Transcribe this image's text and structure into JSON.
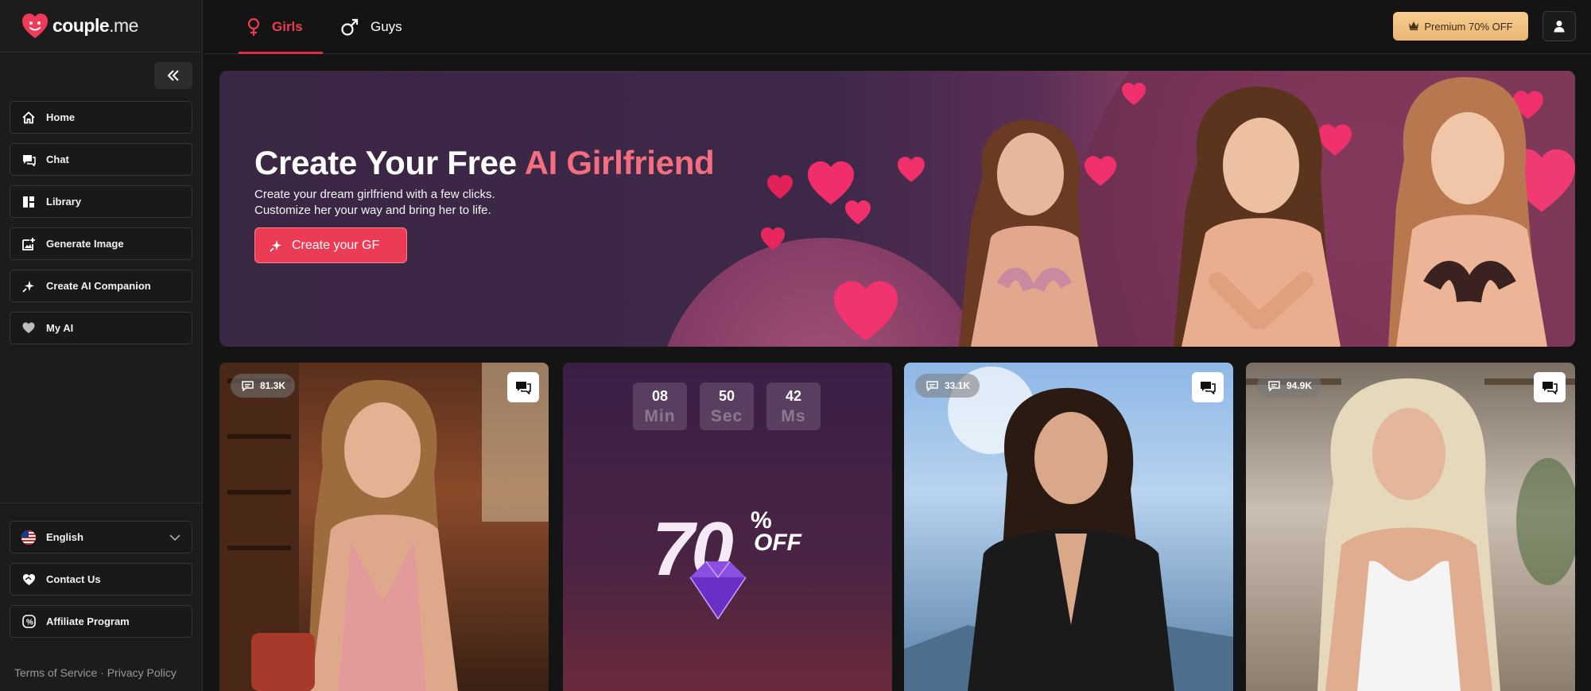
{
  "brand": {
    "name_bold": "couple",
    "name_rest": ".me"
  },
  "sidebar": {
    "items": [
      {
        "label": "Home",
        "icon": "home-icon"
      },
      {
        "label": "Chat",
        "icon": "chat-icon"
      },
      {
        "label": "Library",
        "icon": "library-icon"
      },
      {
        "label": "Generate Image",
        "icon": "generate-image-icon"
      },
      {
        "label": "Create AI Companion",
        "icon": "sparkle-icon"
      },
      {
        "label": "My AI",
        "icon": "heart-icon"
      }
    ],
    "language": {
      "label": "English",
      "icon": "us-flag-icon"
    },
    "contact_label": "Contact Us",
    "affiliate_label": "Affiliate Program",
    "terms_label": "Terms of Service",
    "separator": "·",
    "privacy_label": "Privacy Policy"
  },
  "topbar": {
    "tabs": [
      {
        "label": "Girls",
        "active": true
      },
      {
        "label": "Guys",
        "active": false
      }
    ],
    "premium_label": "Premium 70% OFF"
  },
  "hero": {
    "title_main": "Create Your Free",
    "title_accent": "AI Girlfriend",
    "subtitle_line1": "Create your dream girlfriend with a few clicks.",
    "subtitle_line2": "Customize her your way and bring her to life.",
    "cta_label": "Create your GF"
  },
  "cards": [
    {
      "count": "81.3K"
    },
    {
      "promo": true
    },
    {
      "count": "33.1K"
    },
    {
      "count": "94.9K"
    }
  ],
  "promo": {
    "timer": [
      {
        "value": "08",
        "unit": "Min"
      },
      {
        "value": "50",
        "unit": "Sec"
      },
      {
        "value": "42",
        "unit": "Ms"
      }
    ],
    "big_number": "70",
    "percent": "%",
    "off": "OFF"
  },
  "colors": {
    "accent": "#ec3b55",
    "premium": "#f2c283",
    "background": "#141414"
  }
}
